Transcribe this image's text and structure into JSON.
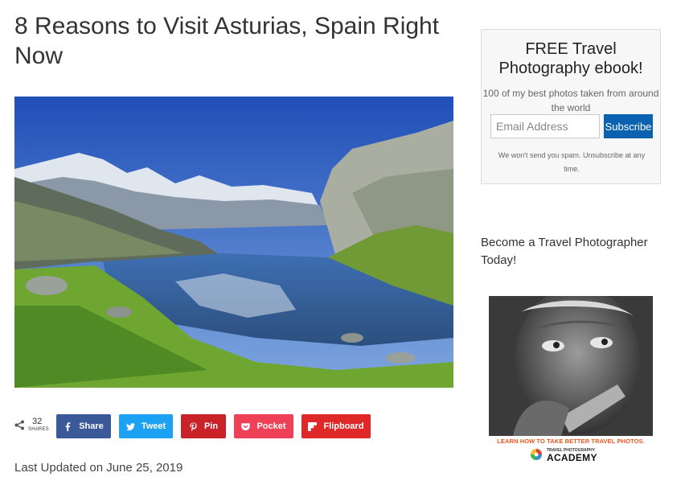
{
  "article": {
    "title": "8 Reasons to Visit Asturias, Spain Right Now",
    "last_updated": "Last Updated on June 25, 2019"
  },
  "share": {
    "count": "32",
    "count_label": "SHARES",
    "buttons": [
      {
        "label": "Share",
        "icon": "facebook-icon",
        "color": "#3b5998"
      },
      {
        "label": "Tweet",
        "icon": "twitter-icon",
        "color": "#1da1f2"
      },
      {
        "label": "Pin",
        "icon": "pinterest-icon",
        "color": "#c92228"
      },
      {
        "label": "Pocket",
        "icon": "pocket-icon",
        "color": "#ee4056"
      },
      {
        "label": "Flipboard",
        "icon": "flipboard-icon",
        "color": "#e12828"
      }
    ]
  },
  "sidebar": {
    "subscribe": {
      "heading": "FREE Travel Photography ebook!",
      "description": "100 of my best photos taken from around the world",
      "email_placeholder": "Email Address",
      "button_label": "Subscribe",
      "note": "We won't send you spam. Unsubscribe at any time."
    },
    "promo_text": "Become a Travel Photographer Today!",
    "ad": {
      "caption": "LEARN HOW TO TAKE BETTER TRAVEL PHOTOS.",
      "brand_small": "TRAVEL PHOTOGRAPHY",
      "brand": "ACADEMY"
    }
  }
}
